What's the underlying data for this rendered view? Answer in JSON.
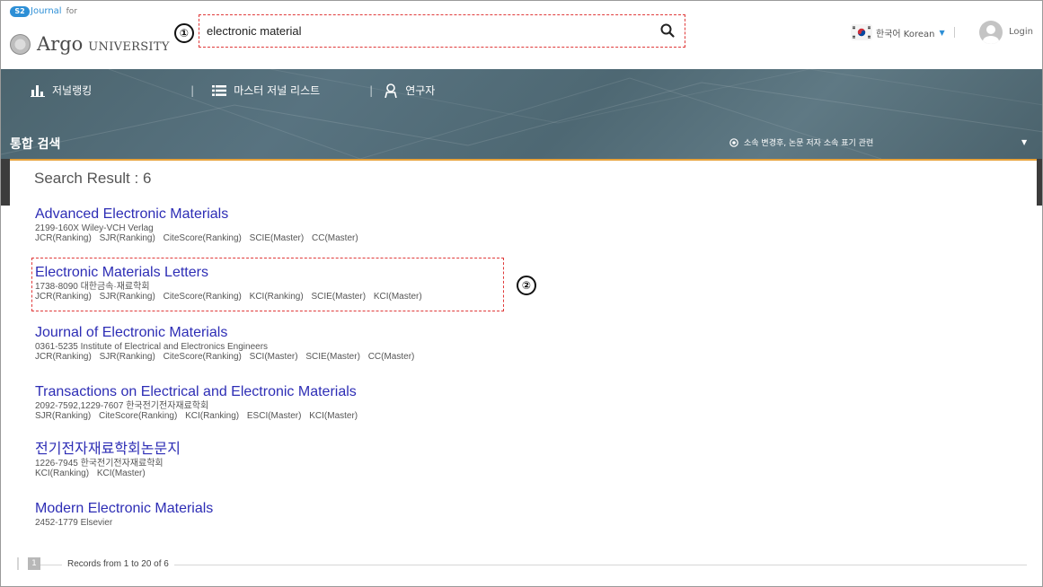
{
  "header": {
    "logo_badge": "S2",
    "logo_journal": "Journal",
    "logo_for": "for",
    "logo_argo": "Argo",
    "logo_university": "UNIVERSITY",
    "search_value": "electronic material",
    "marker_1": "①",
    "language_label": "한국어 Korean",
    "login_label": "Login"
  },
  "nav": {
    "items": [
      {
        "label": "저널랭킹",
        "icon": "bar-chart-icon"
      },
      {
        "label": "마스터 저널 리스트",
        "icon": "list-icon"
      },
      {
        "label": "연구자",
        "icon": "user-icon"
      }
    ],
    "separator": "|",
    "section_title": "통합 검색",
    "affiliation_note": "소속 변경후, 논문 저자 소속 표기 관련"
  },
  "results": {
    "heading": "Search Result : 6",
    "marker_2": "②",
    "journals": [
      {
        "title": "Advanced Electronic Materials",
        "meta": "2199-160X Wiley-VCH Verlag",
        "tags": [
          "JCR(Ranking)",
          "SJR(Ranking)",
          "CiteScore(Ranking)",
          "SCIE(Master)",
          "CC(Master)"
        ]
      },
      {
        "title": "Electronic Materials Letters",
        "meta": "1738-8090 대한금속·재료학회",
        "tags": [
          "JCR(Ranking)",
          "SJR(Ranking)",
          "CiteScore(Ranking)",
          "KCI(Ranking)",
          "SCIE(Master)",
          "KCI(Master)"
        ]
      },
      {
        "title": "Journal of Electronic Materials",
        "meta": "0361-5235 Institute of Electrical and Electronics Engineers",
        "tags": [
          "JCR(Ranking)",
          "SJR(Ranking)",
          "CiteScore(Ranking)",
          "SCI(Master)",
          "SCIE(Master)",
          "CC(Master)"
        ]
      },
      {
        "title": "Transactions on Electrical and Electronic Materials",
        "meta": "2092-7592,1229-7607 한국전기전자재료학회",
        "tags": [
          "SJR(Ranking)",
          "CiteScore(Ranking)",
          "KCI(Ranking)",
          "ESCI(Master)",
          "KCI(Master)"
        ]
      },
      {
        "title": "전기전자재료학회논문지",
        "meta": "1226-7945 한국전기전자재료학회",
        "tags": [
          "KCI(Ranking)",
          "KCI(Master)"
        ]
      },
      {
        "title": "Modern Electronic Materials",
        "meta": "2452-1779 Elsevier",
        "tags": []
      }
    ]
  },
  "pager": {
    "button": "1",
    "text": "Records from 1 to 20 of 6"
  },
  "colors": {
    "accent_blue": "#2d8fd6",
    "link_blue": "#2d2db5",
    "annotation_red": "#e03a3a",
    "nav_bg": "#587380",
    "content_border": "#e8a23a"
  }
}
